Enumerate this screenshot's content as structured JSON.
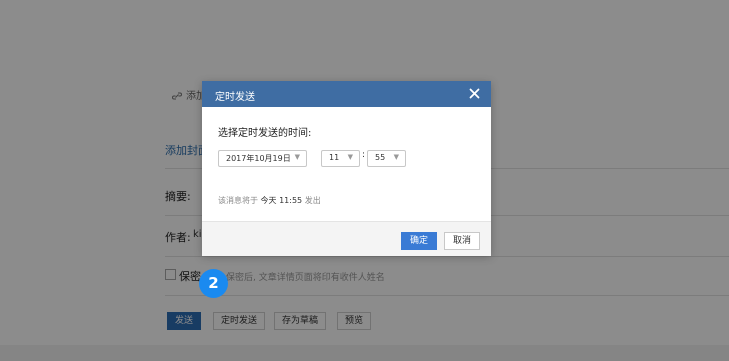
{
  "editor": {
    "attach_label": "添加",
    "add_cover_label": "添加封面",
    "summary_label": "摘要:",
    "author_label": "作者:",
    "author_value": "ki",
    "secret_label": "保密",
    "secret_note": "保密后, 文章详情页面将印有收件人姓名"
  },
  "footer": {
    "send_label": "发送",
    "schedule_label": "定时发送",
    "draft_label": "存为草稿",
    "preview_label": "预览"
  },
  "step_badge": "2",
  "dialog": {
    "title": "定时发送",
    "prompt": "选择定时发送的时间:",
    "date_value": "2017年10月19日",
    "hour_value": "11",
    "minute_value": "55",
    "colon": ":",
    "note_prefix": "该消息将于",
    "note_time": "今天 11:55",
    "note_suffix": "发出",
    "confirm_label": "确定",
    "cancel_label": "取消"
  },
  "colors": {
    "dialog_header": "#3f6da3",
    "primary_button": "#3a7bd5",
    "step_badge": "#1a8af0",
    "link": "#2b6dad"
  },
  "icons": {
    "attach": "link-icon",
    "close": "close-icon",
    "dropdown": "caret-down-icon"
  }
}
